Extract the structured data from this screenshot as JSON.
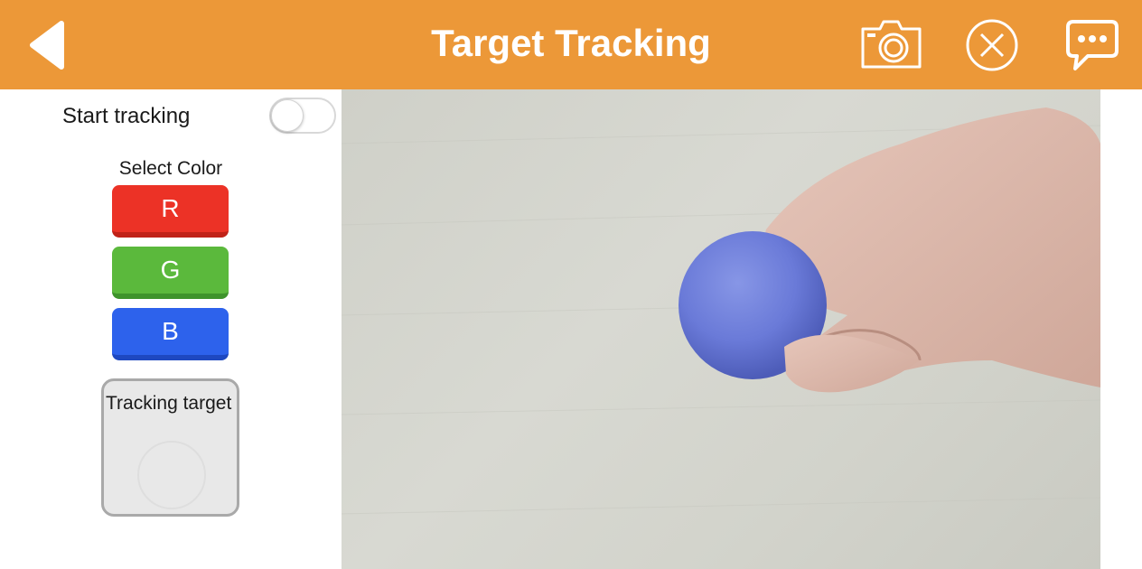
{
  "header": {
    "title": "Target Tracking",
    "bg_color": "#EC9838",
    "icons": [
      "back-arrow-icon",
      "camera-icon",
      "close-circle-icon",
      "chat-bubble-icon"
    ]
  },
  "sidebar": {
    "start_tracking_label": "Start tracking",
    "start_tracking_on": false,
    "select_color_label": "Select Color",
    "colors": [
      {
        "label": "R",
        "color": "#EC3226"
      },
      {
        "label": "G",
        "color": "#5BB93C"
      },
      {
        "label": "B",
        "color": "#2D62EC"
      }
    ],
    "tracking_target_label": "Tracking target"
  }
}
